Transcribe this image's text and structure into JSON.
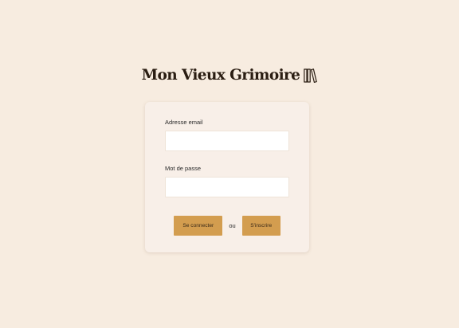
{
  "brand": {
    "title": "Mon Vieux Grimoire",
    "logo_icon": "books-icon",
    "text_color": "#2a1d12"
  },
  "login_form": {
    "email": {
      "label": "Adresse email",
      "value": "",
      "placeholder": ""
    },
    "password": {
      "label": "Mot de passe",
      "value": "",
      "placeholder": ""
    },
    "login_button_label": "Se connecter",
    "separator": "ou",
    "signup_button_label": "S'inscrire"
  },
  "colors": {
    "page_background": "#f7ece0",
    "card_background": "#f8efe8",
    "button_accent": "#d39d4f"
  }
}
